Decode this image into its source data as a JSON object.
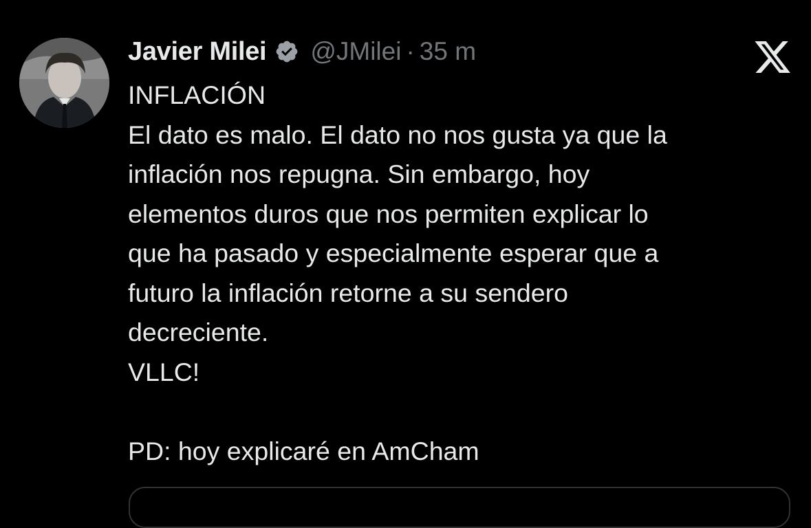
{
  "author": {
    "name": "Javier Milei",
    "handle": "@JMilei",
    "separator": "·",
    "time": "35 m",
    "verified": true
  },
  "brand": {
    "icon": "x-logo-icon"
  },
  "tweet": {
    "lines": [
      "INFLACIÓN",
      "El dato es malo. El dato no nos gusta ya que la",
      "inflación nos repugna. Sin embargo, hoy",
      "elementos duros que nos permiten explicar lo",
      "que ha pasado y especialmente esperar que a",
      "futuro la inflación retorne a su sendero",
      "decreciente.",
      "VLLC!",
      "",
      "PD: hoy explicaré en AmCham"
    ]
  },
  "colors": {
    "background": "#000000",
    "text": "#e7e9ea",
    "secondary": "#71767b",
    "border": "#2f3336"
  }
}
